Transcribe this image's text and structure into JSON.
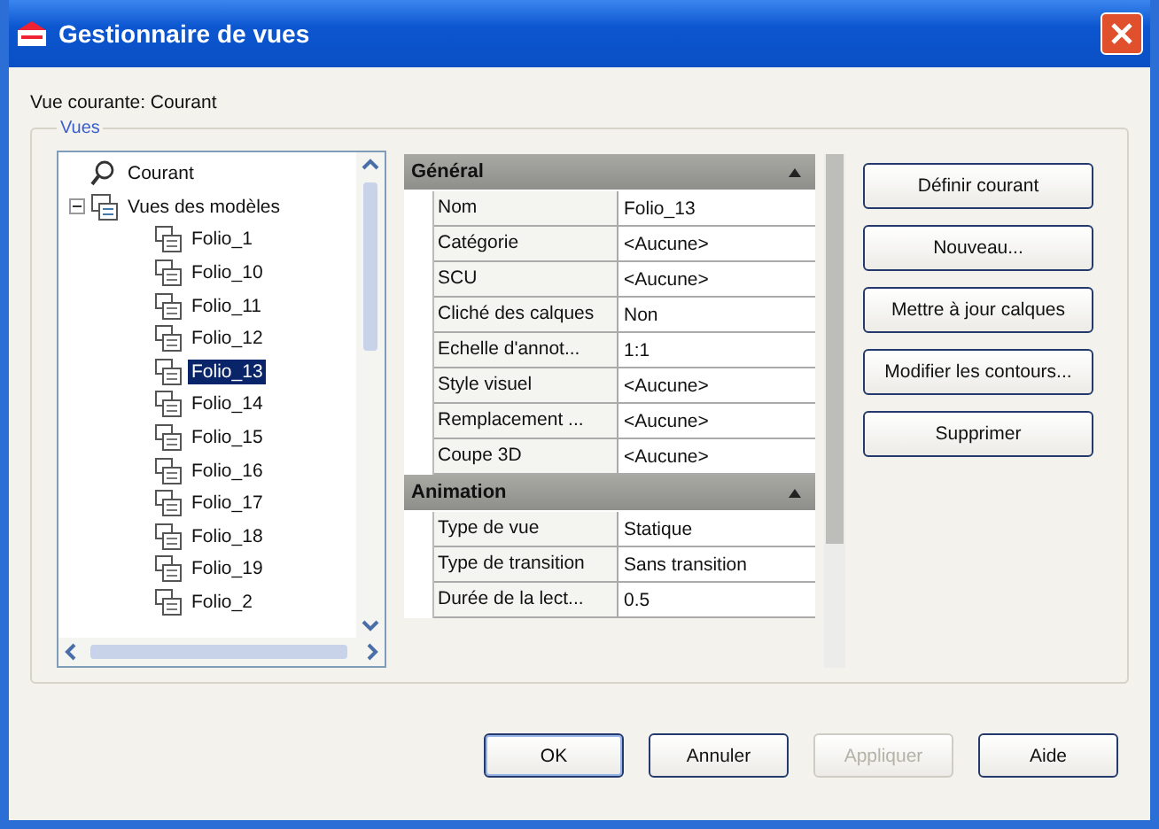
{
  "window": {
    "title": "Gestionnaire de vues"
  },
  "current_view": "Vue courante: Courant",
  "group": {
    "label": "Vues"
  },
  "tree": [
    {
      "label": "Courant",
      "kind": "camera",
      "selected": false
    },
    {
      "label": "Vues des modèles",
      "kind": "folder",
      "expanded": true,
      "selected": false,
      "children": [
        {
          "label": "Folio_1",
          "kind": "view",
          "selected": false
        },
        {
          "label": "Folio_10",
          "kind": "view",
          "selected": false
        },
        {
          "label": "Folio_11",
          "kind": "view",
          "selected": false
        },
        {
          "label": "Folio_12",
          "kind": "view",
          "selected": false
        },
        {
          "label": "Folio_13",
          "kind": "view",
          "selected": true
        },
        {
          "label": "Folio_14",
          "kind": "view",
          "selected": false
        },
        {
          "label": "Folio_15",
          "kind": "view",
          "selected": false
        },
        {
          "label": "Folio_16",
          "kind": "view",
          "selected": false
        },
        {
          "label": "Folio_17",
          "kind": "view",
          "selected": false
        },
        {
          "label": "Folio_18",
          "kind": "view",
          "selected": false
        },
        {
          "label": "Folio_19",
          "kind": "view",
          "selected": false
        },
        {
          "label": "Folio_2",
          "kind": "view",
          "selected": false
        }
      ]
    }
  ],
  "properties": [
    {
      "title": "Général",
      "expanded": true,
      "rows": [
        {
          "name": "Nom",
          "value": "Folio_13"
        },
        {
          "name": "Catégorie",
          "value": "<Aucune>"
        },
        {
          "name": "SCU",
          "value": "<Aucune>"
        },
        {
          "name": "Cliché des calques",
          "value": "Non"
        },
        {
          "name": "Echelle d'annot...",
          "value": "1:1"
        },
        {
          "name": "Style visuel",
          "value": "<Aucune>"
        },
        {
          "name": "Remplacement ...",
          "value": "<Aucune>"
        },
        {
          "name": "Coupe 3D",
          "value": "<Aucune>"
        }
      ]
    },
    {
      "title": "Animation",
      "expanded": true,
      "rows": [
        {
          "name": "Type de vue",
          "value": "Statique"
        },
        {
          "name": "Type de transition",
          "value": "Sans transition"
        },
        {
          "name": "Durée de la lect...",
          "value": "0.5"
        }
      ]
    }
  ],
  "side_buttons": [
    {
      "label": "Définir courant"
    },
    {
      "label": "Nouveau..."
    },
    {
      "label": "Mettre à jour calques"
    },
    {
      "label": "Modifier les contours..."
    },
    {
      "label": "Supprimer"
    }
  ],
  "buttons": [
    {
      "label": "OK",
      "disabled": false,
      "default": true
    },
    {
      "label": "Annuler",
      "disabled": false,
      "default": false
    },
    {
      "label": "Appliquer",
      "disabled": true,
      "default": false
    },
    {
      "label": "Aide",
      "disabled": false,
      "default": false
    }
  ]
}
